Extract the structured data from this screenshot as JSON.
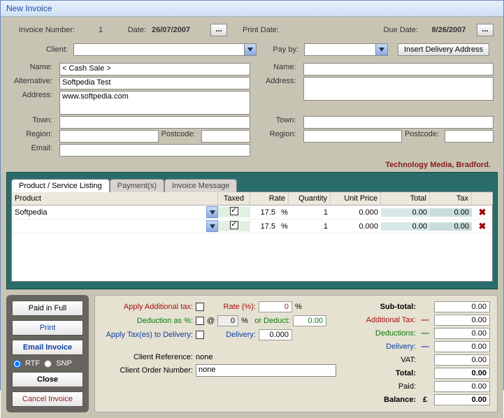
{
  "window": {
    "title": "New Invoice"
  },
  "header": {
    "invnum_lbl": "Invoice Number:",
    "invnum": "1",
    "date_lbl": "Date:",
    "date": "26/07/2007",
    "printdate_lbl": "Print Date:",
    "duedate_lbl": "Due Date:",
    "duedate": "8/26/2007",
    "client_lbl": "Client:",
    "payby_lbl": "Pay by:",
    "insert_delivery": "Insert Delivery Address",
    "name_lbl": "Name:",
    "name_val": "< Cash Sale >",
    "alt_lbl": "Alternative:",
    "alt_val": "Softpedia Test",
    "addr_lbl": "Address:",
    "addr_val": "www.softpedia.com",
    "town_lbl": "Town:",
    "region_lbl": "Region:",
    "postcode_lbl": "Postcode:",
    "email_lbl": "Email:",
    "name2_lbl": "Name:",
    "addr2_lbl": "Address:",
    "tagline": "Technology Media, Bradford."
  },
  "tabs": {
    "t1": "Product / Service Listing",
    "t2": "Payment(s)",
    "t3": "Invoice Message"
  },
  "grid": {
    "head_product": "Product",
    "head_taxed": "Taxed",
    "head_rate": "Rate",
    "head_qty": "Quantity",
    "head_unit": "Unit Price",
    "head_total": "Total",
    "head_tax": "Tax",
    "rows": [
      {
        "product": "Softpedia",
        "taxed": true,
        "rate": "17.5",
        "ratepct": "%",
        "qty": "1",
        "unit": "0.000",
        "total": "0.00",
        "tax": "0.00"
      },
      {
        "product": "",
        "taxed": true,
        "rate": "17.5",
        "ratepct": "%",
        "qty": "1",
        "unit": "0.000",
        "total": "0.00",
        "tax": "0.00"
      }
    ]
  },
  "sidebuttons": {
    "paid_full": "Paid in Full",
    "print": "Print",
    "email": "Email Invoice",
    "rtf": "RTF",
    "snp": "SNP",
    "close": "Close",
    "cancel": "Cancel  Invoice"
  },
  "bottom": {
    "apply_add_tax_lbl": "Apply Additional tax:",
    "rate_pct_lbl": "Rate (%):",
    "rate_pct_val": "0",
    "deduct_pct_lbl": "Deduction as %:",
    "deduct_pct_val": "0",
    "pct": "%",
    "at": "@",
    "or_deduct_lbl": "or Deduct:",
    "or_deduct_val": "0.00",
    "apply_tax_del_lbl": "Apply Tax(es) to Delivery:",
    "delivery_lbl": "Delivery:",
    "delivery_val": "0.000",
    "client_ref_lbl": "Client Reference:",
    "client_ref_val": "none",
    "client_order_lbl": "Client Order Number:",
    "client_order_val": "none",
    "dash": "—"
  },
  "totals": {
    "subtotal_lbl": "Sub-total:",
    "subtotal": "0.00",
    "addtax_lbl": "Additional Tax:",
    "addtax": "0.00",
    "deductions_lbl": "Deductions:",
    "deductions": "0.00",
    "delivery_lbl": "Delivery:",
    "delivery": "0.00",
    "vat_lbl": "VAT:",
    "vat": "0.00",
    "total_lbl": "Total:",
    "total": "0.00",
    "paid_lbl": "Paid:",
    "paid": "0.00",
    "balance_lbl": "Balance:",
    "currency": "£",
    "balance": "0.00"
  }
}
